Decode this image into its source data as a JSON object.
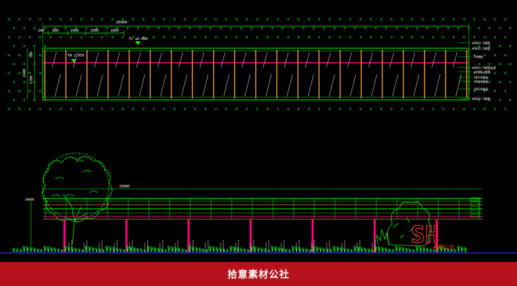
{
  "elevation": {
    "overall_dim": "20000",
    "seg_dims": [
      "200",
      "800",
      "1000",
      "1000",
      "1000"
    ],
    "fl_label": "FL ±0.000",
    "tw_label": "TW 2.050",
    "height_dims": [
      "2400",
      "1700",
      "700"
    ],
    "annotations": [
      "Φ50X2.5钢管",
      "Φ50X2.5钢管",
      "-10钢板",
      "Φ50X2.5钢管连接",
      "-10钢板/钢管",
      "-50X10钢板",
      "-50X10钢板",
      "-50X10钢板",
      "Φ50X2.5钢管"
    ]
  },
  "section": {
    "overall_dim": "20000",
    "level_label": "10000"
  },
  "watermark": {
    "logo": "SH",
    "sub": "素材公社"
  },
  "footer": {
    "text": "拾意素材公社"
  },
  "colors": {
    "line_green": "#00ff00",
    "column_orange": "#d88a3a",
    "beam_magenta": "#ff0080",
    "footer_red": "#b5121b"
  }
}
